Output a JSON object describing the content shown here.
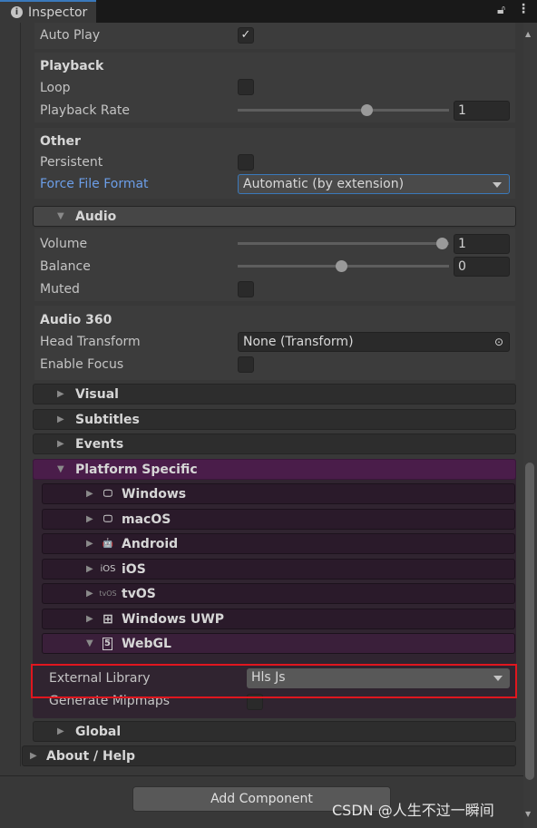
{
  "window": {
    "tab_title": "Inspector",
    "lock_icon": "lock-icon",
    "menu_icon": "kebab-menu-icon"
  },
  "settings": {
    "auto_play": {
      "label": "Auto Play",
      "checked": true
    },
    "playback": {
      "title": "Playback",
      "loop": {
        "label": "Loop",
        "checked": false
      },
      "rate": {
        "label": "Playback Rate",
        "value": "1",
        "slider": 0.5
      }
    },
    "other": {
      "title": "Other",
      "persistent": {
        "label": "Persistent",
        "checked": false
      },
      "force_format": {
        "label": "Force File Format",
        "value": "Automatic (by extension)"
      }
    }
  },
  "audio": {
    "header": "Audio",
    "volume": {
      "label": "Volume",
      "value": "1",
      "slider": 1.0
    },
    "balance": {
      "label": "Balance",
      "value": "0",
      "slider": 0.5
    },
    "muted": {
      "label": "Muted",
      "checked": false
    },
    "audio360": {
      "title": "Audio 360",
      "head_transform": {
        "label": "Head Transform",
        "value": "None (Transform)"
      },
      "enable_focus": {
        "label": "Enable Focus",
        "checked": false
      }
    }
  },
  "sections": {
    "visual": "Visual",
    "subtitles": "Subtitles",
    "events": "Events",
    "platform": "Platform Specific",
    "global": "Global",
    "about": "About / Help"
  },
  "platforms": [
    {
      "label": "Windows",
      "icon": "monitor-icon",
      "icon_text": "🖵"
    },
    {
      "label": "macOS",
      "icon": "monitor-icon",
      "icon_text": "🖵"
    },
    {
      "label": "Android",
      "icon": "android-icon",
      "icon_text": "🤖"
    },
    {
      "label": "iOS",
      "icon": "ios-icon",
      "icon_text": "iOS"
    },
    {
      "label": "tvOS",
      "icon": "tvos-icon",
      "icon_text": "tvOS"
    },
    {
      "label": "Windows UWP",
      "icon": "windows-logo-icon",
      "icon_text": "⊞"
    },
    {
      "label": "WebGL",
      "icon": "html5-icon",
      "icon_text": "5"
    }
  ],
  "webgl": {
    "external_library": {
      "label": "External Library",
      "value": "Hls Js"
    },
    "generate_mipmaps": {
      "label": "Generate Mipmaps",
      "checked": false
    }
  },
  "footer": {
    "add_component": "Add Component",
    "watermark": "CSDN @人生不过一瞬间"
  },
  "colors": {
    "accent": "#3a79bb",
    "highlight_label": "#6c9ee8",
    "platform_header": "#4a1d4a",
    "annotation_box": "#e0161e"
  }
}
